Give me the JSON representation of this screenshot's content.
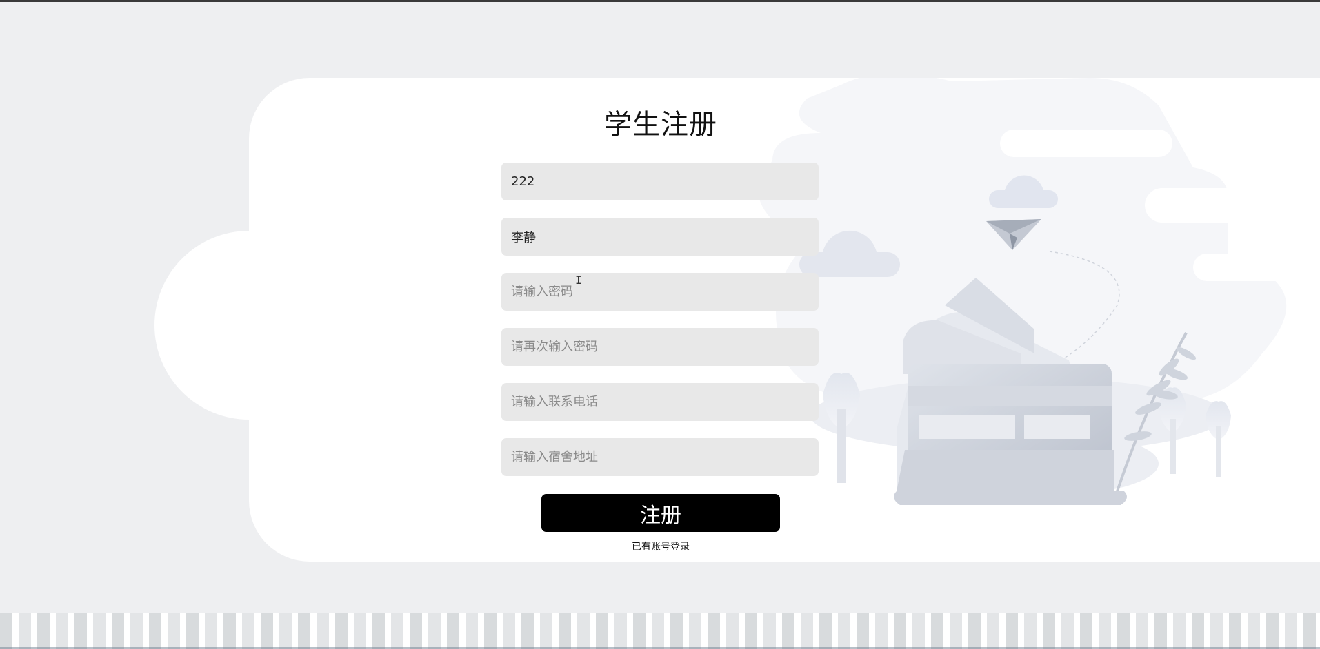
{
  "form": {
    "title": "学生注册",
    "fields": [
      {
        "name": "student-id-field",
        "value": "222",
        "placeholder": ""
      },
      {
        "name": "student-name-field",
        "value": "李静",
        "placeholder": ""
      },
      {
        "name": "password-field",
        "value": "",
        "placeholder": "请输入密码"
      },
      {
        "name": "confirm-password-field",
        "value": "",
        "placeholder": "请再次输入密码"
      },
      {
        "name": "phone-field",
        "value": "",
        "placeholder": "请输入联系电话"
      },
      {
        "name": "dorm-address-field",
        "value": "",
        "placeholder": "请输入宿舍地址"
      }
    ],
    "submit_label": "注册",
    "login_link": "已有账号登录"
  },
  "colors": {
    "page_bg": "#eeeff1",
    "card_bg": "#ffffff",
    "field_bg": "#e8e8e8",
    "button_bg": "#000000",
    "button_text": "#ffffff"
  },
  "icons": [
    "paper-plane-icon",
    "cloud-icon",
    "tree-icon",
    "plant-icon",
    "card-wallet-illustration"
  ]
}
